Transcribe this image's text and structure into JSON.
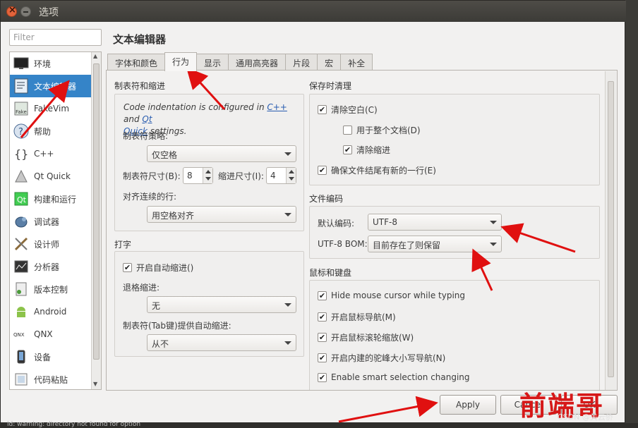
{
  "window": {
    "title": "选项"
  },
  "filter": {
    "placeholder": "Filter"
  },
  "sidebar": {
    "items": [
      {
        "label": "环境"
      },
      {
        "label": "文本编辑器"
      },
      {
        "label": "FakeVim"
      },
      {
        "label": "帮助"
      },
      {
        "label": "C++"
      },
      {
        "label": "Qt Quick"
      },
      {
        "label": "构建和运行"
      },
      {
        "label": "调试器"
      },
      {
        "label": "设计师"
      },
      {
        "label": "分析器"
      },
      {
        "label": "版本控制"
      },
      {
        "label": "Android"
      },
      {
        "label": "QNX"
      },
      {
        "label": "设备"
      },
      {
        "label": "代码粘贴"
      }
    ]
  },
  "page": {
    "title": "文本编辑器"
  },
  "tabs": [
    "字体和颜色",
    "行为",
    "显示",
    "通用高亮器",
    "片段",
    "宏",
    "补全"
  ],
  "tabs_and_indent": {
    "title": "制表符和缩进",
    "note_pre": "Code indentation is configured in ",
    "note_link1": "C++",
    "note_mid": " and ",
    "note_link2": "Qt",
    "note_link3": "Quick",
    "note_post": " settings.",
    "policy_label": "制表符策略:",
    "policy_value": "仅空格",
    "tab_size_label": "制表符尺寸(B):",
    "tab_size_value": "8",
    "indent_size_label": "缩进尺寸(I):",
    "indent_size_value": "4",
    "align_label": "对齐连续的行:",
    "align_value": "用空格对齐"
  },
  "typing": {
    "title": "打字",
    "auto_indent": "开启自动缩进()",
    "backspace_label": "退格缩进:",
    "backspace_value": "无",
    "tab_key_label": "制表符(Tab键)提供自动缩进:",
    "tab_key_value": "从不"
  },
  "cleanup": {
    "title": "保存时清理",
    "clean_ws": "清除空白(C)",
    "whole_doc": "用于整个文档(D)",
    "clean_indent": "清除缩进",
    "newline": "确保文件结尾有新的一行(E)"
  },
  "encoding": {
    "title": "文件编码",
    "default_label": "默认编码:",
    "default_value": "UTF-8",
    "bom_label": "UTF-8 BOM:",
    "bom_value": "目前存在了则保留"
  },
  "mouse": {
    "title": "鼠标和键盘",
    "hide_cursor": "Hide mouse cursor while typing",
    "mouse_nav": "开启鼠标导航(M)",
    "wheel_zoom": "开启鼠标滚轮缩放(W)",
    "camel_nav": "开启内建的驼峰大小写导航(N)",
    "smart_sel": "Enable smart selection changing"
  },
  "buttons": {
    "apply": "Apply",
    "cancel": "Cancel",
    "ok": "OK"
  },
  "watermark": {
    "text": "前端哥",
    "csdn": "CSDN @关云侨"
  },
  "statusline": {
    "text": "ld: warning: directory not found for option"
  }
}
